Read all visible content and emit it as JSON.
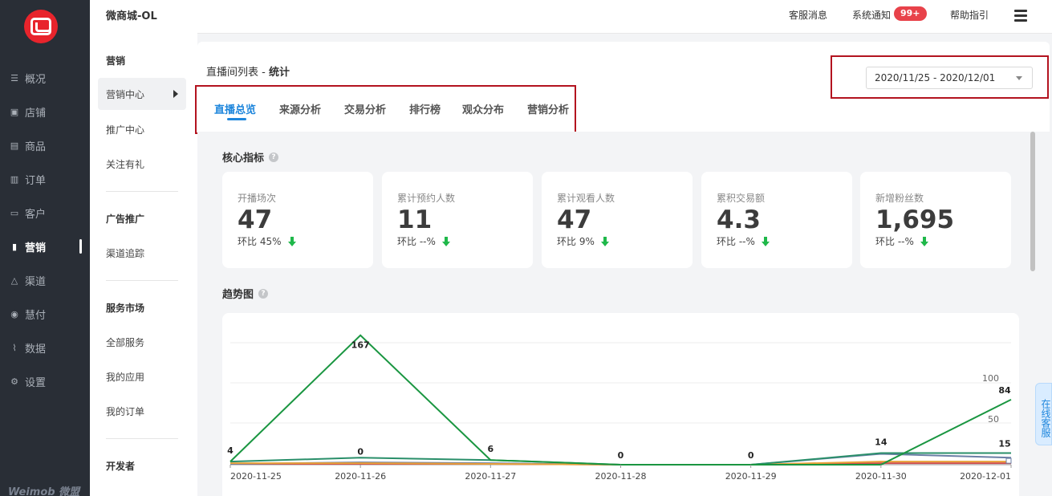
{
  "nav": {
    "items": [
      {
        "label": "概况",
        "icon": "list-icon"
      },
      {
        "label": "店铺",
        "icon": "store-icon"
      },
      {
        "label": "商品",
        "icon": "product-icon"
      },
      {
        "label": "订单",
        "icon": "order-icon"
      },
      {
        "label": "客户",
        "icon": "customer-icon"
      },
      {
        "label": "营销",
        "icon": "marketing-icon",
        "active": true
      },
      {
        "label": "渠道",
        "icon": "channel-icon"
      },
      {
        "label": "慧付",
        "icon": "pay-icon"
      },
      {
        "label": "数据",
        "icon": "data-icon"
      },
      {
        "label": "设置",
        "icon": "settings-icon"
      }
    ],
    "brand": "Weimob 微盟"
  },
  "subnav": {
    "app_title": "微商城-OL",
    "group1": "营销",
    "item_active": "营销中心",
    "item_promo": "推广中心",
    "item_follow": "关注有礼",
    "group2": "广告推广",
    "item_channel": "渠道追踪",
    "group3": "服务市场",
    "item_all": "全部服务",
    "item_apps": "我的应用",
    "item_orders": "我的订单",
    "group4": "开发者"
  },
  "topbar": {
    "cs_msg": "客服消息",
    "sys_notice": "系统通知",
    "badge": "99+",
    "help": "帮助指引"
  },
  "page": {
    "breadcrumb_parent": "直播间列表",
    "breadcrumb_sep": " - ",
    "breadcrumb_current": "统计",
    "date_range": "2020/11/25 - 2020/12/01",
    "tabs": [
      "直播总览",
      "来源分析",
      "交易分析",
      "排行榜",
      "观众分布",
      "营销分析"
    ],
    "core_title": "核心指标",
    "trend_title": "趋势图"
  },
  "kpis": [
    {
      "label": "开播场次",
      "value": "47",
      "ratio": "环比 45%"
    },
    {
      "label": "累计预约人数",
      "value": "11",
      "ratio": "环比 --%"
    },
    {
      "label": "累计观看人数",
      "value": "47",
      "ratio": "环比 9%"
    },
    {
      "label": "累积交易额",
      "value": "4.3",
      "ratio": "环比 --%"
    },
    {
      "label": "新增粉丝数",
      "value": "1,695",
      "ratio": "环比 --%"
    }
  ],
  "chart_data": {
    "type": "line",
    "x": [
      "2020-11-25",
      "2020-11-26",
      "2020-11-27",
      "2020-11-28",
      "2020-11-29",
      "2020-11-30",
      "2020-12-01"
    ],
    "y_right_ticks": [
      "50",
      "100"
    ],
    "series": [
      {
        "color": "#1a9641",
        "values": [
          4,
          167,
          6,
          0,
          0,
          0,
          84
        ]
      },
      {
        "color": "#2a8f6a",
        "values": [
          4,
          9,
          6,
          0,
          0,
          15,
          15
        ]
      },
      {
        "color": "#e8a23a",
        "values": [
          2,
          2,
          1,
          0,
          0,
          4,
          4
        ]
      },
      {
        "color": "#6b7fa6",
        "values": [
          1,
          3,
          2,
          0,
          0,
          14,
          9
        ]
      },
      {
        "color": "#d04c4c",
        "values": [
          1,
          1,
          1,
          0,
          0,
          2,
          2
        ]
      }
    ],
    "point_labels": [
      {
        "x": "2020-11-25",
        "text": "4"
      },
      {
        "x": "2020-11-26",
        "text": "167"
      },
      {
        "x": "2020-11-26",
        "text": "0"
      },
      {
        "x": "2020-11-27",
        "text": "6"
      },
      {
        "x": "2020-11-28",
        "text": "0"
      },
      {
        "x": "2020-11-29",
        "text": "0"
      },
      {
        "x": "2020-11-30",
        "text": "14"
      },
      {
        "x": "2020-12-01",
        "text": "84"
      },
      {
        "x": "2020-12-01",
        "text": "15"
      }
    ]
  },
  "online_cs": "在线客服"
}
